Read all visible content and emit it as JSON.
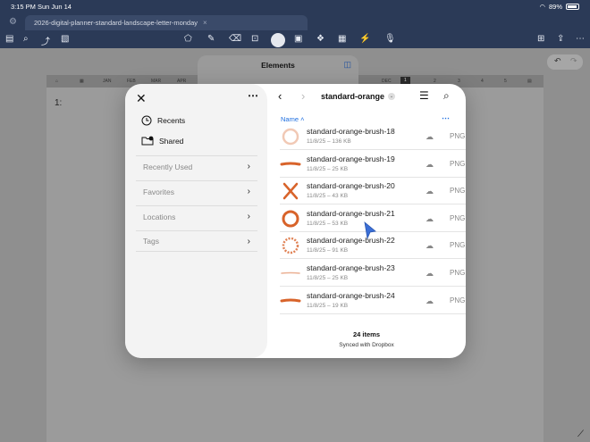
{
  "status": {
    "time": "3:15 PM",
    "date": "Sun Jun 14",
    "battery": "89%"
  },
  "tab": {
    "title": "2026-digital-planner-standard-landscape-letter-monday",
    "close": "×"
  },
  "planner": {
    "months": [
      "JAN",
      "FEB",
      "MAR",
      "APR",
      "DEC"
    ],
    "days": [
      "1",
      "2",
      "3",
      "4",
      "5"
    ],
    "page_label": "1:"
  },
  "elements_panel": {
    "title": "Elements"
  },
  "sidebar": {
    "items": [
      {
        "label": "Recents",
        "icon": "clock-icon"
      },
      {
        "label": "Shared",
        "icon": "shared-folder-icon"
      }
    ],
    "sections": [
      {
        "label": "Recently Used"
      },
      {
        "label": "Favorites"
      },
      {
        "label": "Locations"
      },
      {
        "label": "Tags"
      }
    ]
  },
  "browser": {
    "folder": "standard-orange",
    "sort_label": "Name",
    "files": [
      {
        "name": "standard-orange-brush-18",
        "meta": "11/8/25 – 136 KB",
        "type": "PNG",
        "thumb": "ring-faint"
      },
      {
        "name": "standard-orange-brush-19",
        "meta": "11/8/25 – 25 KB",
        "type": "PNG",
        "thumb": "stroke"
      },
      {
        "name": "standard-orange-brush-20",
        "meta": "11/8/25 – 43 KB",
        "type": "PNG",
        "thumb": "cross"
      },
      {
        "name": "standard-orange-brush-21",
        "meta": "11/8/25 – 53 KB",
        "type": "PNG",
        "thumb": "ring"
      },
      {
        "name": "standard-orange-brush-22",
        "meta": "11/8/25 – 91 KB",
        "type": "PNG",
        "thumb": "ring-dotted"
      },
      {
        "name": "standard-orange-brush-23",
        "meta": "11/8/25 – 25 KB",
        "type": "PNG",
        "thumb": "stroke-faint"
      },
      {
        "name": "standard-orange-brush-24",
        "meta": "11/8/25 – 19 KB",
        "type": "PNG",
        "thumb": "stroke"
      }
    ],
    "count": "24 items",
    "sync": "Synced with Dropbox"
  },
  "colors": {
    "accent": "#1f6fe0",
    "brush": "#d8632a",
    "topbar": "#2b3a57"
  }
}
